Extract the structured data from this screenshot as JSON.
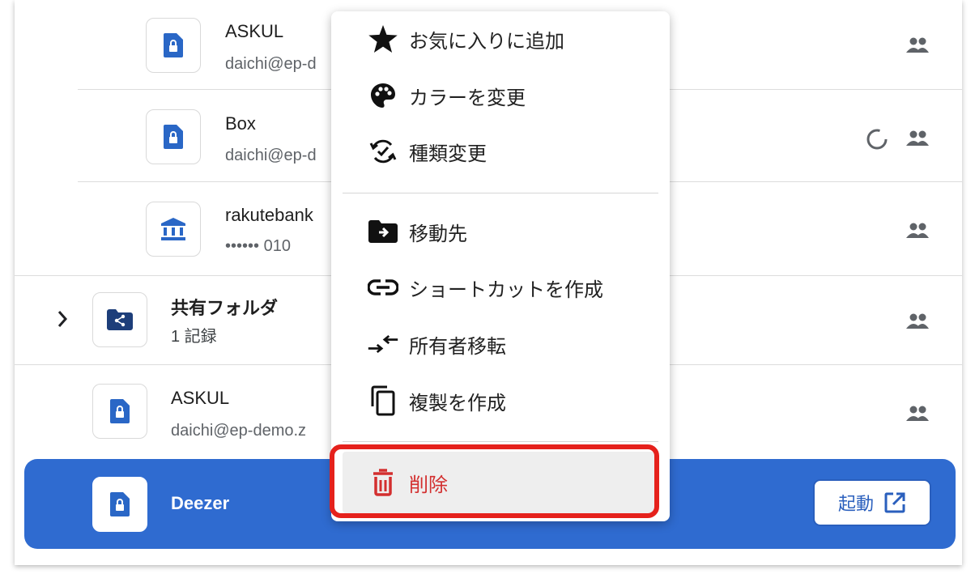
{
  "list": {
    "rows": [
      {
        "name": "ASKUL",
        "sub": "daichi@ep-d",
        "icon": "lock-doc-icon"
      },
      {
        "name": "Box",
        "sub": "daichi@ep-d",
        "icon": "lock-doc-icon"
      },
      {
        "name": "rakutebank",
        "sub": "•••••• 010",
        "icon": "bank-icon"
      },
      {
        "name": "共有フォルダ",
        "sub": "1 記録",
        "icon": "shared-folder-icon"
      },
      {
        "name": "ASKUL",
        "sub": "daichi@ep-demo.z",
        "icon": "lock-doc-icon"
      }
    ],
    "selected": {
      "name": "Deezer",
      "launch_label": "起動"
    }
  },
  "menu": {
    "items": [
      {
        "label": "お気に入りに追加",
        "icon": "star-icon"
      },
      {
        "label": "カラーを変更",
        "icon": "palette-icon"
      },
      {
        "label": "種類変更",
        "icon": "change-type-icon"
      },
      {
        "label": "移動先",
        "icon": "move-to-folder-icon"
      },
      {
        "label": "ショートカットを作成",
        "icon": "link-icon"
      },
      {
        "label": "所有者移転",
        "icon": "transfer-icon"
      },
      {
        "label": "複製を作成",
        "icon": "copy-icon"
      },
      {
        "label": "削除",
        "icon": "trash-icon"
      }
    ]
  },
  "colors": {
    "selected_bg": "#2f6bd0",
    "accent": "#2a5fbd",
    "delete_red": "#d32f2f",
    "highlight_outline": "#e5211c"
  }
}
